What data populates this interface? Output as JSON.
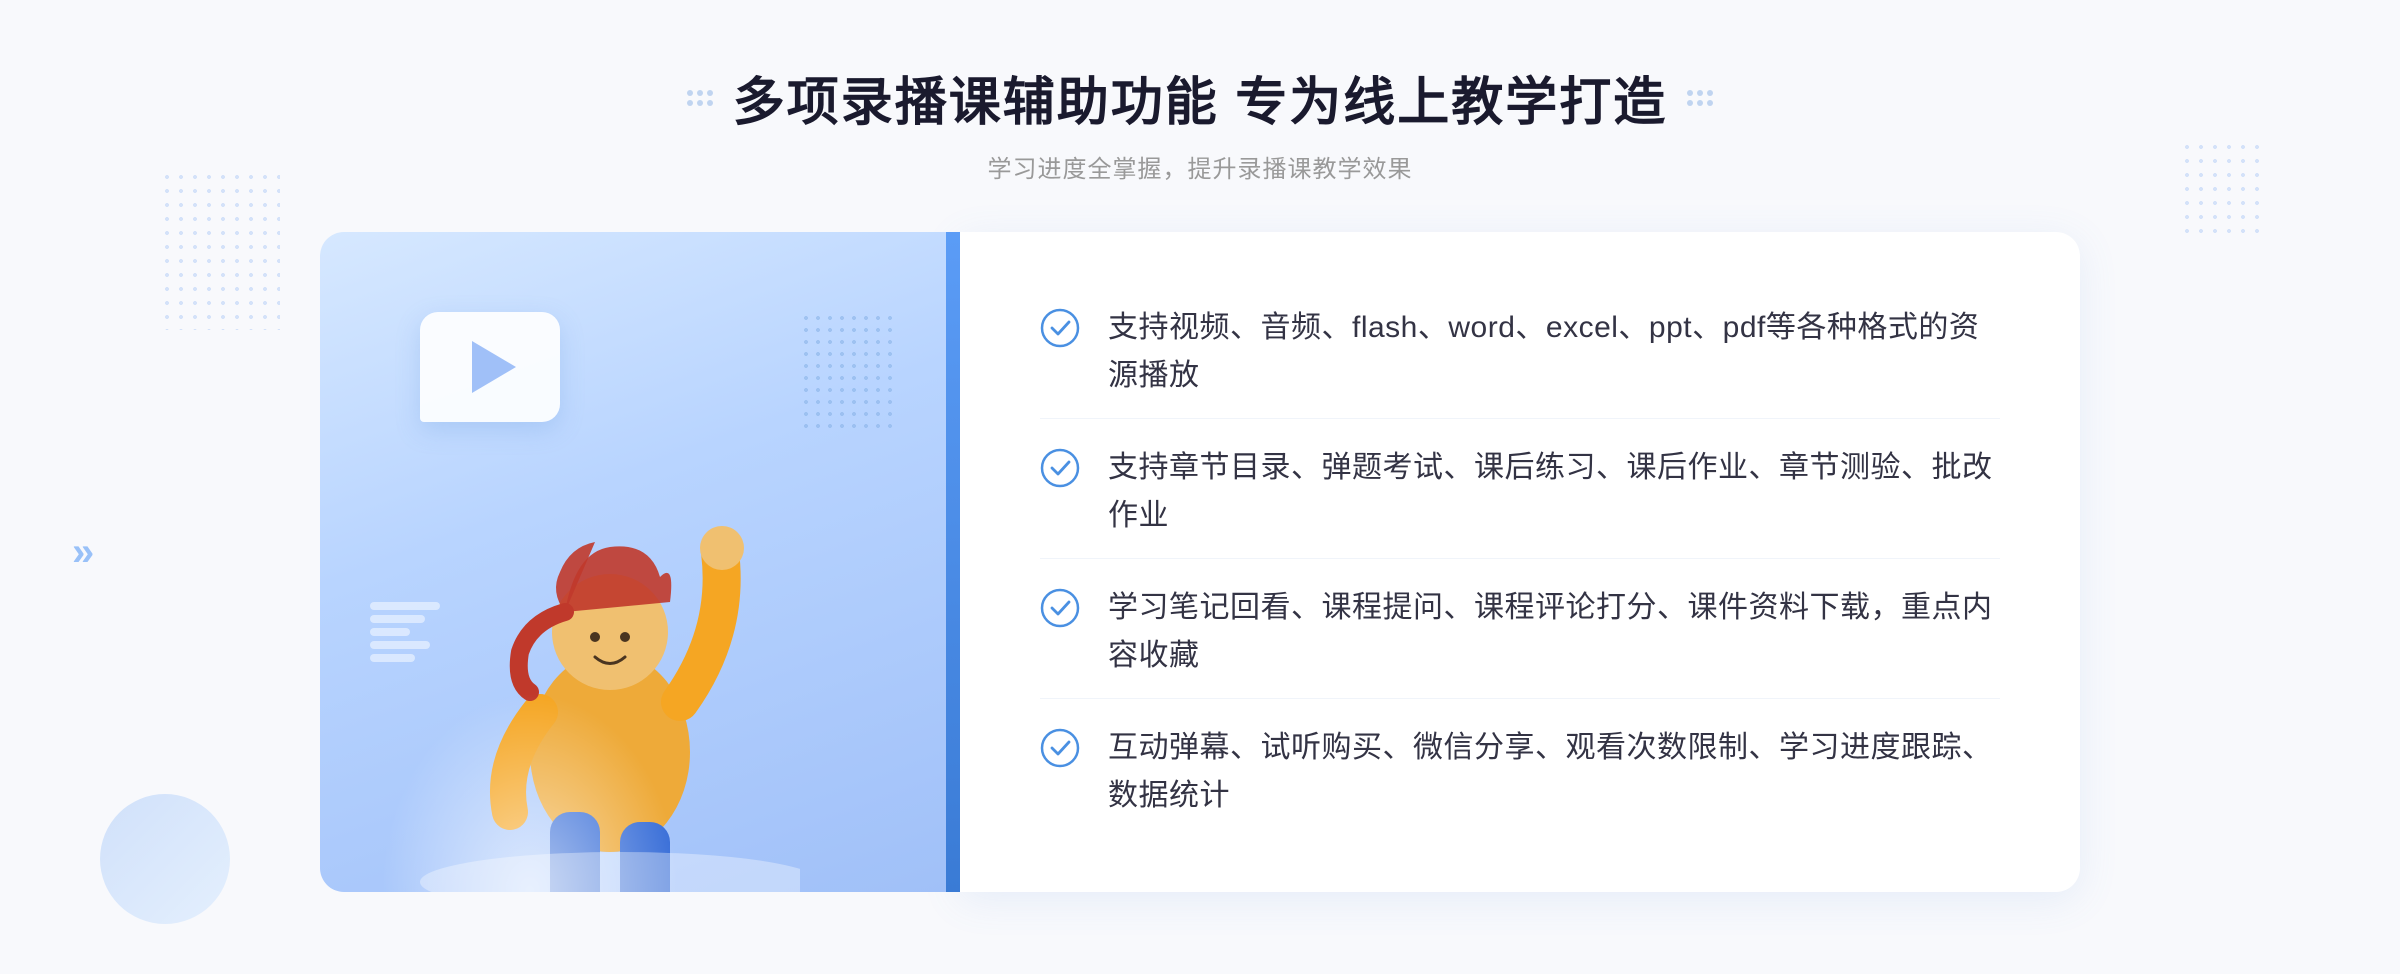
{
  "page": {
    "background": "#f8f9fc"
  },
  "header": {
    "title": "多项录播课辅助功能 专为线上教学打造",
    "subtitle": "学习进度全掌握，提升录播课教学效果",
    "decorator_dots": "grid-dots-icon"
  },
  "features": [
    {
      "id": 1,
      "text": "支持视频、音频、flash、word、excel、ppt、pdf等各种格式的资源播放"
    },
    {
      "id": 2,
      "text": "支持章节目录、弹题考试、课后练习、课后作业、章节测验、批改作业"
    },
    {
      "id": 3,
      "text": "学习笔记回看、课程提问、课程评论打分、课件资料下载，重点内容收藏"
    },
    {
      "id": 4,
      "text": "互动弹幕、试听购买、微信分享、观看次数限制、学习进度跟踪、数据统计"
    }
  ],
  "colors": {
    "primary_blue": "#5b9cf6",
    "light_blue": "#a0c0f8",
    "check_blue": "#4a90e2",
    "text_dark": "#333344",
    "text_subtitle": "#999999"
  },
  "icons": {
    "check": "circle-check-icon",
    "play": "play-button-icon",
    "arrow": "chevron-right-icon"
  }
}
